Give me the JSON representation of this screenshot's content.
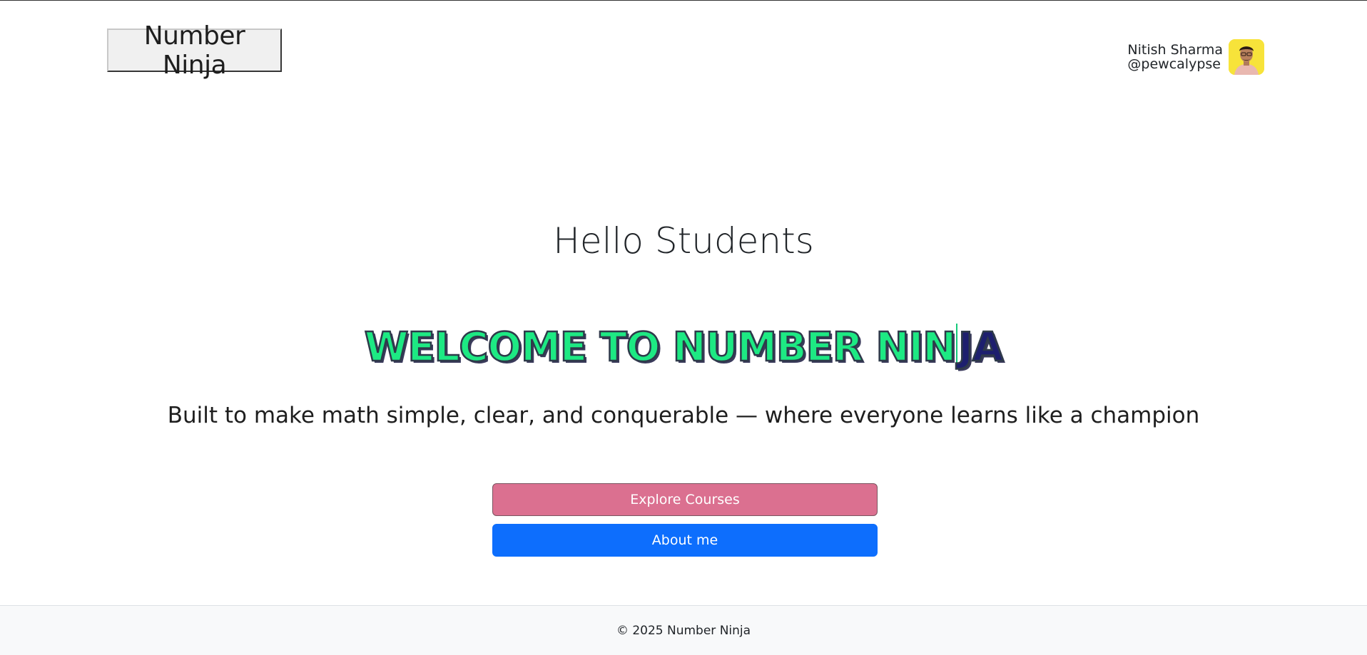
{
  "header": {
    "brand_label": "Number Ninja"
  },
  "profile": {
    "name": "Nitish Sharma",
    "handle": "@pewcalypse"
  },
  "hero": {
    "greeting": "Hello Students",
    "headline_typed": "WELCOME TO NUMBER NIN",
    "headline_rest": "JA",
    "tagline": "Built to make math simple, clear, and conquerable — where everyone learns like a champion"
  },
  "actions": {
    "explore_label": "Explore Courses",
    "about_label": "About me"
  },
  "footer": {
    "copyright": "© 2025 Number Ninja"
  },
  "colors": {
    "explore_button": "#db7090",
    "about_button": "#0d6efd",
    "headline_typed": "#1de983",
    "headline_rest": "#1d1f6e",
    "avatar_bg": "#f7e33a"
  }
}
